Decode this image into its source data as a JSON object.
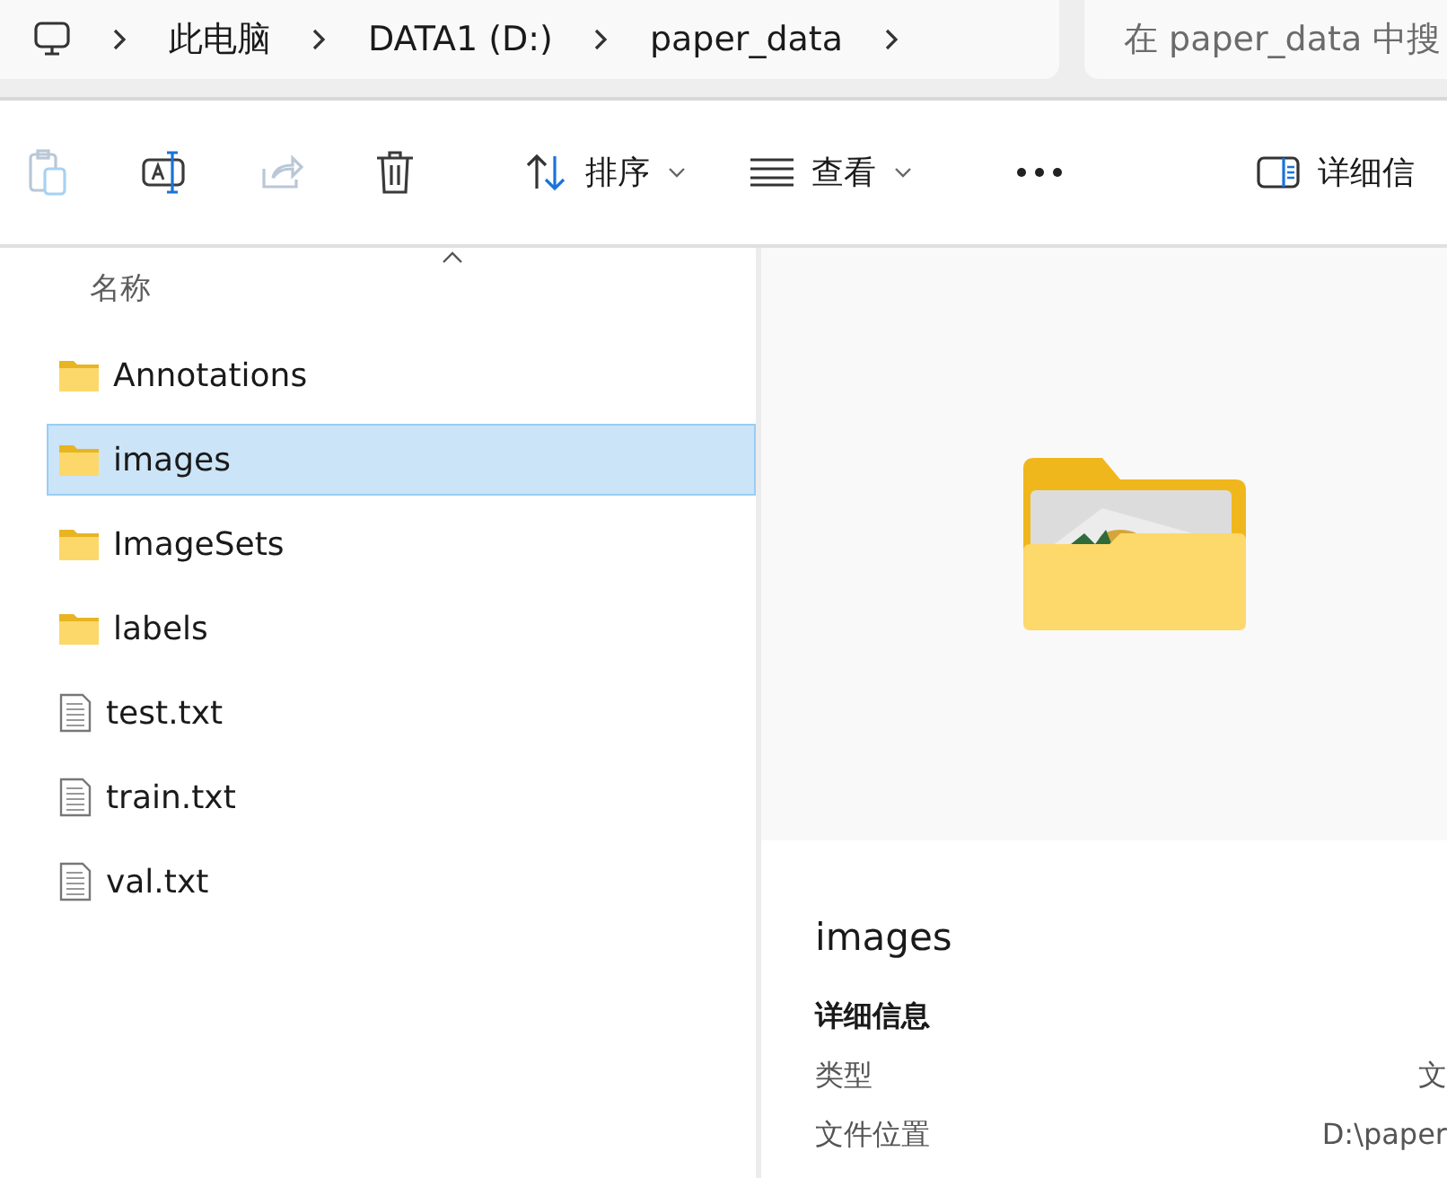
{
  "breadcrumb": [
    "此电脑",
    "DATA1 (D:)",
    "paper_data"
  ],
  "search": {
    "placeholder": "在 paper_data 中搜"
  },
  "toolbar": {
    "actions": [
      {
        "kind": "paste",
        "disabled": true
      },
      {
        "kind": "rename",
        "disabled": false
      },
      {
        "kind": "share",
        "disabled": true
      },
      {
        "kind": "delete",
        "disabled": false
      }
    ],
    "sort": "排序",
    "view": "查看",
    "details": "详细信"
  },
  "column_header": "名称",
  "files": [
    {
      "name": "Annotations",
      "kind": "folder",
      "selected": false
    },
    {
      "name": "images",
      "kind": "folder",
      "selected": true
    },
    {
      "name": "ImageSets",
      "kind": "folder",
      "selected": false
    },
    {
      "name": "labels",
      "kind": "folder",
      "selected": false
    },
    {
      "name": "test.txt",
      "kind": "text",
      "selected": false
    },
    {
      "name": "train.txt",
      "kind": "text",
      "selected": false
    },
    {
      "name": "val.txt",
      "kind": "text",
      "selected": false
    }
  ],
  "preview": {
    "title": "images",
    "section": "详细信息",
    "properties": [
      {
        "label": "类型",
        "value": "文"
      },
      {
        "label": "文件位置",
        "value": "D:\\paper"
      }
    ]
  }
}
